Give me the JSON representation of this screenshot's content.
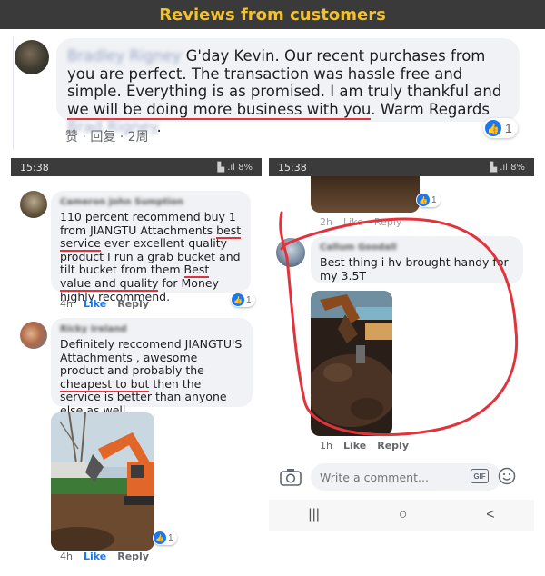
{
  "banner": {
    "title": "Reviews from customers"
  },
  "top_review": {
    "author": "Bradley Rigney",
    "text_1": "G'day Kevin. Our recent purchases from you are perfect. The transaction was hassle free and simple. Everything is as promised. I am truly thankful and ",
    "text_highlight": "we will be doing more business with you",
    "text_2": ". Warm Regards ",
    "signoff": "Brad Rigney",
    "end": ".",
    "meta": "赞 · 回复 · 2周",
    "like_count": "1"
  },
  "left_phone": {
    "status_time": "15:38",
    "status_right": "▙ .ıl 8%",
    "comment1": {
      "author": "Cameron John Sumption",
      "t1": "110 percent recommend buy 1 from JIANGTU Attachments ",
      "h1": "best service",
      "t2": " ever excellent quality product I run a grab bucket and tilt bucket from them ",
      "h2": "Best value and quality",
      "t3": " for Money highly recommend.",
      "time": "4h",
      "like": "Like",
      "reply": "Reply",
      "likes": "1"
    },
    "comment2": {
      "author": "Ricky Ireland",
      "t1": "Definitely reccomend JIANGTU'S Attachments , awesome product and probably the ",
      "h1": "cheapest to but",
      "t2": " then the service is better than anyone else as well...",
      "time": "4h",
      "like": "Like",
      "reply": "Reply",
      "likes": "1"
    }
  },
  "right_phone": {
    "status_time": "15:38",
    "status_right": "▙ .ıl 8%",
    "prev_meta": {
      "time": "2h",
      "like": "Like",
      "reply": "Reply",
      "likes": "1"
    },
    "comment": {
      "author": "Callum Goodall",
      "text": "Best thing i hv brought handy for my 3.5T",
      "time": "1h",
      "like": "Like",
      "reply": "Reply"
    },
    "composer_placeholder": "Write a comment...",
    "nav": {
      "recent": "|||",
      "home": "○",
      "back": "<"
    }
  },
  "colors": {
    "accent": "#1877f2",
    "highlight_red": "#e0333c",
    "banner_bg": "#3a3a3a",
    "banner_text": "#f2c12e"
  }
}
